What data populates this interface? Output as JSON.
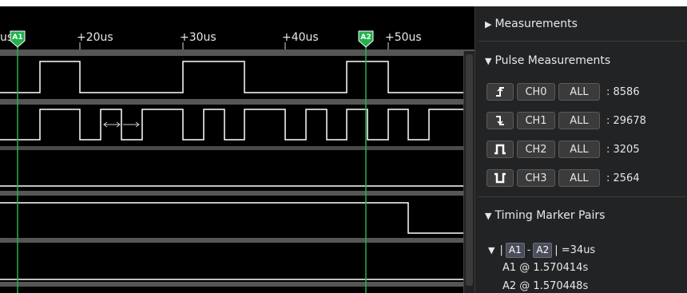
{
  "ruler": {
    "ticks": [
      "+20us",
      "+30us",
      "+40us",
      "+50us"
    ],
    "left_fragment": "us",
    "markers": [
      "A1",
      "A2"
    ]
  },
  "panel": {
    "measurements_title": "Measurements",
    "pulse_title": "Pulse Measurements",
    "pulse_rows": [
      {
        "edge": "falling-edge-icon",
        "channel": "CH0",
        "scope": "ALL",
        "value": ": 8586"
      },
      {
        "edge": "rising-edge-icon",
        "channel": "CH1",
        "scope": "ALL",
        "value": ": 29678"
      },
      {
        "edge": "positive-pulse-icon",
        "channel": "CH2",
        "scope": "ALL",
        "value": ": 3205"
      },
      {
        "edge": "negative-pulse-icon",
        "channel": "CH3",
        "scope": "ALL",
        "value": ": 2564"
      }
    ],
    "timing_title": "Timing Marker Pairs",
    "pair": {
      "bar_left": "|",
      "m1": "A1",
      "dash": "-",
      "m2": "A2",
      "result": "| =34us",
      "a1_time": "A1 @ 1.570414s",
      "a2_time": "A2 @ 1.570448s"
    }
  },
  "colors": {
    "background": "#000000",
    "trace": "#ffffff",
    "marker": "#22b14c",
    "panel": "#222324"
  }
}
